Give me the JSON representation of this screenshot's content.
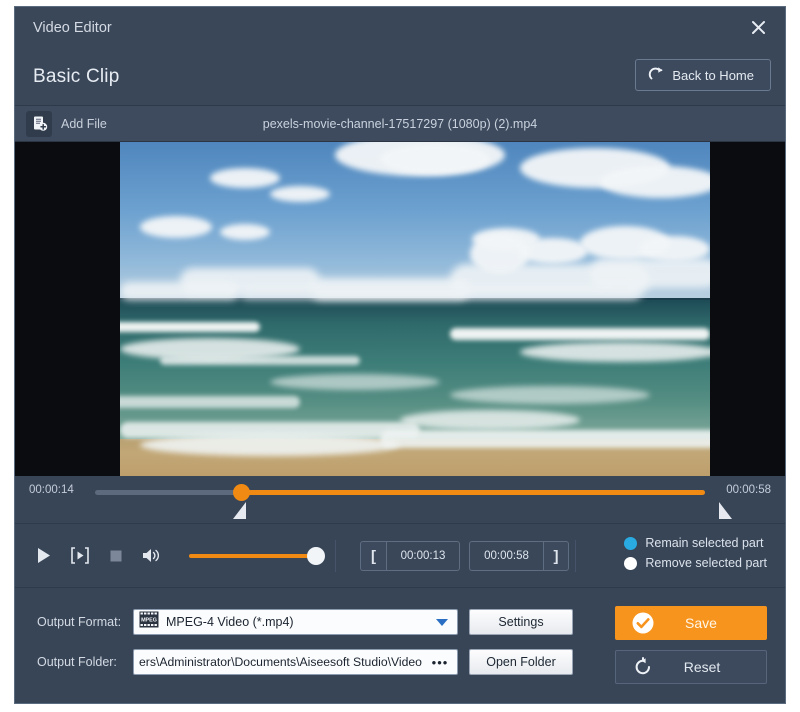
{
  "window": {
    "title": "Video Editor",
    "close_icon": "close-icon",
    "accent_color": "#f7941e",
    "panel_color": "#384557",
    "selected_color": "#29abe2"
  },
  "header": {
    "page_title": "Basic Clip",
    "back_home": {
      "label": "Back to Home",
      "icon": "redo-arrow-icon"
    }
  },
  "filebar": {
    "add_file": {
      "label": "Add File",
      "icon": "add-file-icon"
    },
    "filename": "pexels-movie-channel-17517297 (1080p) (2).mp4"
  },
  "preview": {
    "scene": "ocean-beach-video-frame"
  },
  "timeline": {
    "start_time": "00:00:14",
    "end_time": "00:00:58",
    "playhead_percent": 24,
    "trim_left_handle": "trim-start-handle",
    "trim_right_handle": "trim-end-handle"
  },
  "controls": {
    "play_icon": "play-icon",
    "snapshot_icon": "frame-step-icon",
    "stop_icon": "stop-icon",
    "volume_icon": "speaker-icon",
    "volume_percent": 100,
    "clip_start": "00:00:13",
    "clip_end": "00:00:58",
    "bracket_left": "[",
    "bracket_right": "]",
    "options": [
      {
        "label": "Remain selected part",
        "selected": true,
        "color": "#29abe2"
      },
      {
        "label": "Remove selected part",
        "selected": false,
        "color": "#ffffff"
      }
    ]
  },
  "output": {
    "format_label": "Output Format:",
    "format_value": "MPEG-4 Video (*.mp4)",
    "format_icon": "mpeg-film-icon",
    "settings_label": "Settings",
    "folder_label": "Output Folder:",
    "folder_value": "ers\\Administrator\\Documents\\Aiseesoft Studio\\Video",
    "browse_label": "•••",
    "open_folder_label": "Open Folder",
    "save_label": "Save",
    "save_icon": "check-circle-icon",
    "reset_label": "Reset",
    "reset_icon": "refresh-ccw-icon"
  }
}
